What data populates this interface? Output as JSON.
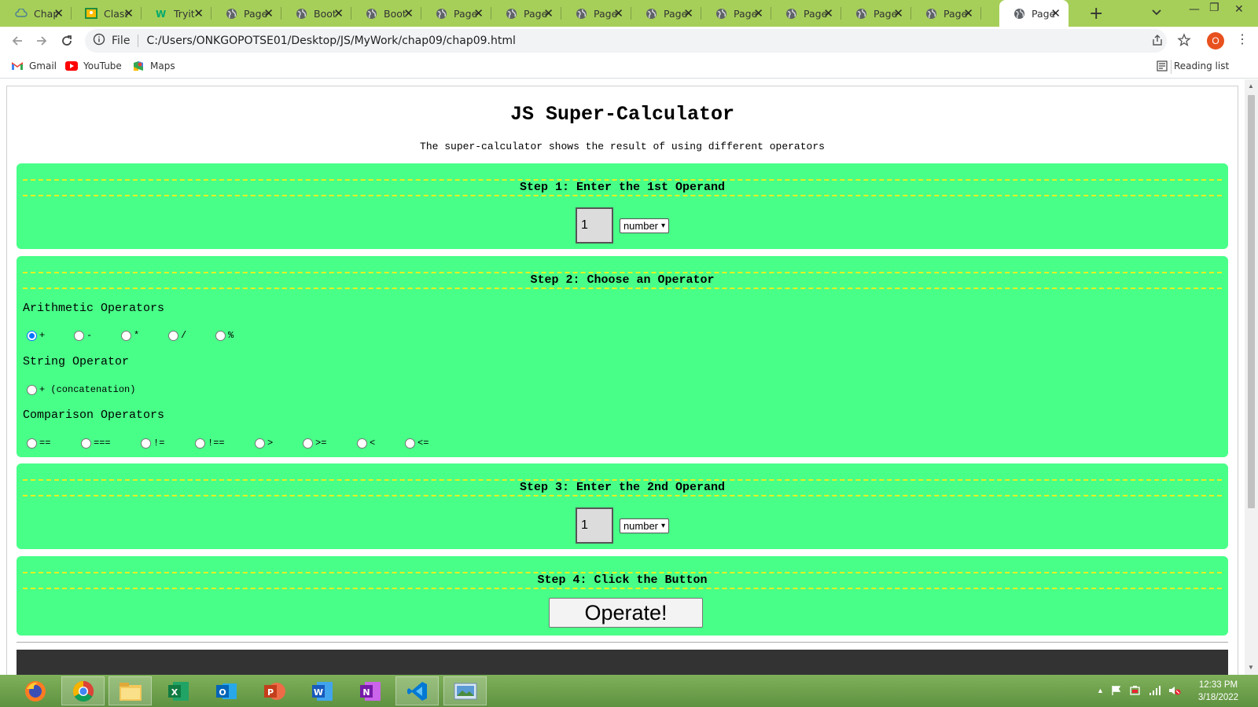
{
  "browser": {
    "tabs": [
      {
        "label": "Chap",
        "icon": "cloud-icon"
      },
      {
        "label": "Class",
        "icon": "classroom-icon"
      },
      {
        "label": "Tryit",
        "icon": "w3schools-icon"
      },
      {
        "label": "Page",
        "icon": "globe-icon"
      },
      {
        "label": "Boot",
        "icon": "globe-icon"
      },
      {
        "label": "Boot",
        "icon": "globe-icon"
      },
      {
        "label": "Page",
        "icon": "globe-icon"
      },
      {
        "label": "Page",
        "icon": "globe-icon"
      },
      {
        "label": "Page",
        "icon": "globe-icon"
      },
      {
        "label": "Page",
        "icon": "globe-icon"
      },
      {
        "label": "Page",
        "icon": "globe-icon"
      },
      {
        "label": "Page",
        "icon": "globe-icon"
      },
      {
        "label": "Page",
        "icon": "globe-icon"
      },
      {
        "label": "Page",
        "icon": "globe-icon"
      },
      {
        "label": "Page",
        "icon": "globe-icon",
        "active": true
      }
    ],
    "address": {
      "scheme_label": "File",
      "url": "C:/Users/ONKGOPOTSE01/Desktop/JS/MyWork/chap09/chap09.html"
    },
    "profile_initial": "O",
    "bookmarks": [
      {
        "label": "Gmail",
        "icon": "gmail-icon"
      },
      {
        "label": "YouTube",
        "icon": "youtube-icon"
      },
      {
        "label": "Maps",
        "icon": "maps-icon"
      }
    ],
    "reading_list_label": "Reading list"
  },
  "page": {
    "title": "JS Super-Calculator",
    "subtitle": "The super-calculator shows the result of using different operators",
    "step1": {
      "heading": "Step 1: Enter the 1st Operand",
      "value": "1",
      "type": "number"
    },
    "step2": {
      "heading": "Step 2: Choose an Operator",
      "arithmetic_label": "Arithmetic Operators",
      "arithmetic": [
        "+",
        "-",
        "*",
        "/",
        "%"
      ],
      "arithmetic_selected": "+",
      "string_label": "String Operator",
      "string_option": "+ (concatenation)",
      "comparison_label": "Comparison Operators",
      "comparison": [
        "==",
        "===",
        "!=",
        "!==",
        ">",
        ">=",
        "<",
        "<="
      ]
    },
    "step3": {
      "heading": "Step 3: Enter the 2nd Operand",
      "value": "1",
      "type": "number"
    },
    "step4": {
      "heading": "Step 4: Click the Button",
      "button_label": "Operate!"
    },
    "panel_color": "#48ff88",
    "heading_border_color": "#e6f020"
  },
  "taskbar": {
    "apps": [
      {
        "name": "firefox-icon"
      },
      {
        "name": "chrome-icon",
        "running": true
      },
      {
        "name": "file-explorer-icon",
        "running": true
      },
      {
        "name": "excel-icon"
      },
      {
        "name": "outlook-icon"
      },
      {
        "name": "powerpoint-icon"
      },
      {
        "name": "word-icon"
      },
      {
        "name": "onenote-icon"
      },
      {
        "name": "vscode-icon",
        "running": true
      },
      {
        "name": "screenshot-tool-icon",
        "running": true
      }
    ],
    "clock": {
      "time": "12:33 PM",
      "date": "3/18/2022"
    }
  }
}
